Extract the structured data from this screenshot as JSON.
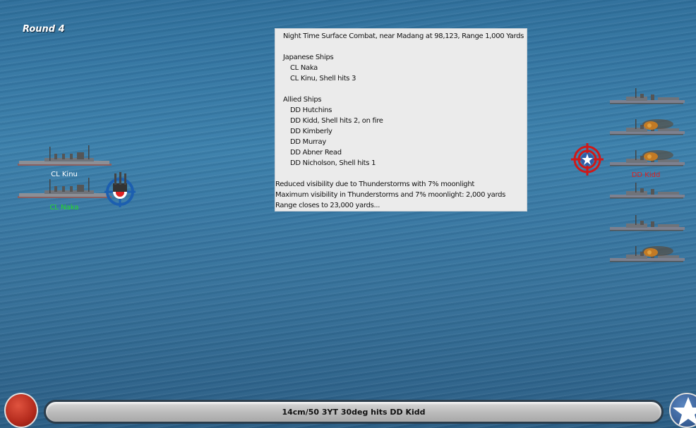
{
  "round_label": "Round 4",
  "report": {
    "title": "Night Time Surface Combat, near Madang at 98,123, Range 1,000 Yards",
    "japanese_header": "Japanese Ships",
    "japanese_ships": [
      "CL Naka",
      "CL Kinu, Shell hits 3"
    ],
    "allied_header": "Allied Ships",
    "allied_ships": [
      "DD Hutchins",
      "DD Kidd, Shell hits 2,  on fire",
      "DD Kimberly",
      "DD Murray",
      "DD Abner Read",
      "DD Nicholson, Shell hits 1"
    ],
    "messages": [
      "Reduced visibility due to Thunderstorms with 7% moonlight",
      "Maximum visibility in Thunderstorms and 7% moonlight: 2,000 yards",
      "Range closes to 23,000 yards..."
    ]
  },
  "japanese_labels": {
    "kinu": "CL Kinu",
    "naka": "CL Naka"
  },
  "allied_labels": {
    "kidd": "DD Kidd"
  },
  "status_message": "14cm/50 3YT 30deg hits DD Kidd",
  "colors": {
    "selected_label": "#22dd22",
    "target_label": "#dd2222",
    "normal_label": "#ffffff"
  }
}
